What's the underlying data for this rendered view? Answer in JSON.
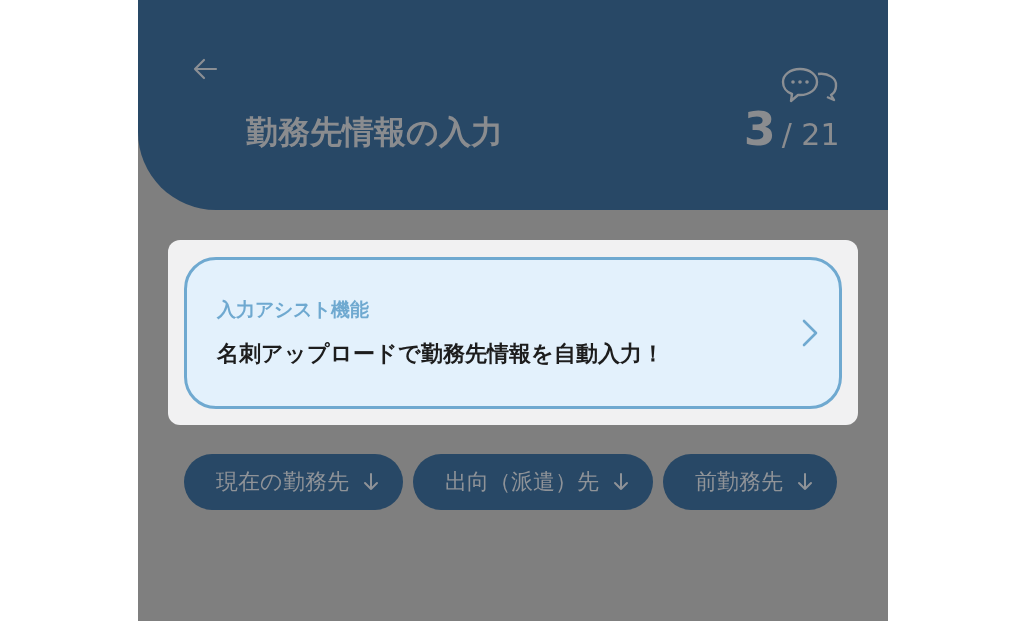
{
  "header": {
    "title": "勤務先情報の入力",
    "counter": {
      "current": "3",
      "total": "/ 21"
    }
  },
  "assist": {
    "label": "入力アシスト機能",
    "text": "名刺アップロードで勤務先情報を自動入力！"
  },
  "chips": [
    {
      "label": "現在の勤務先"
    },
    {
      "label": "出向（派遣）先"
    },
    {
      "label": "前勤務先"
    }
  ]
}
